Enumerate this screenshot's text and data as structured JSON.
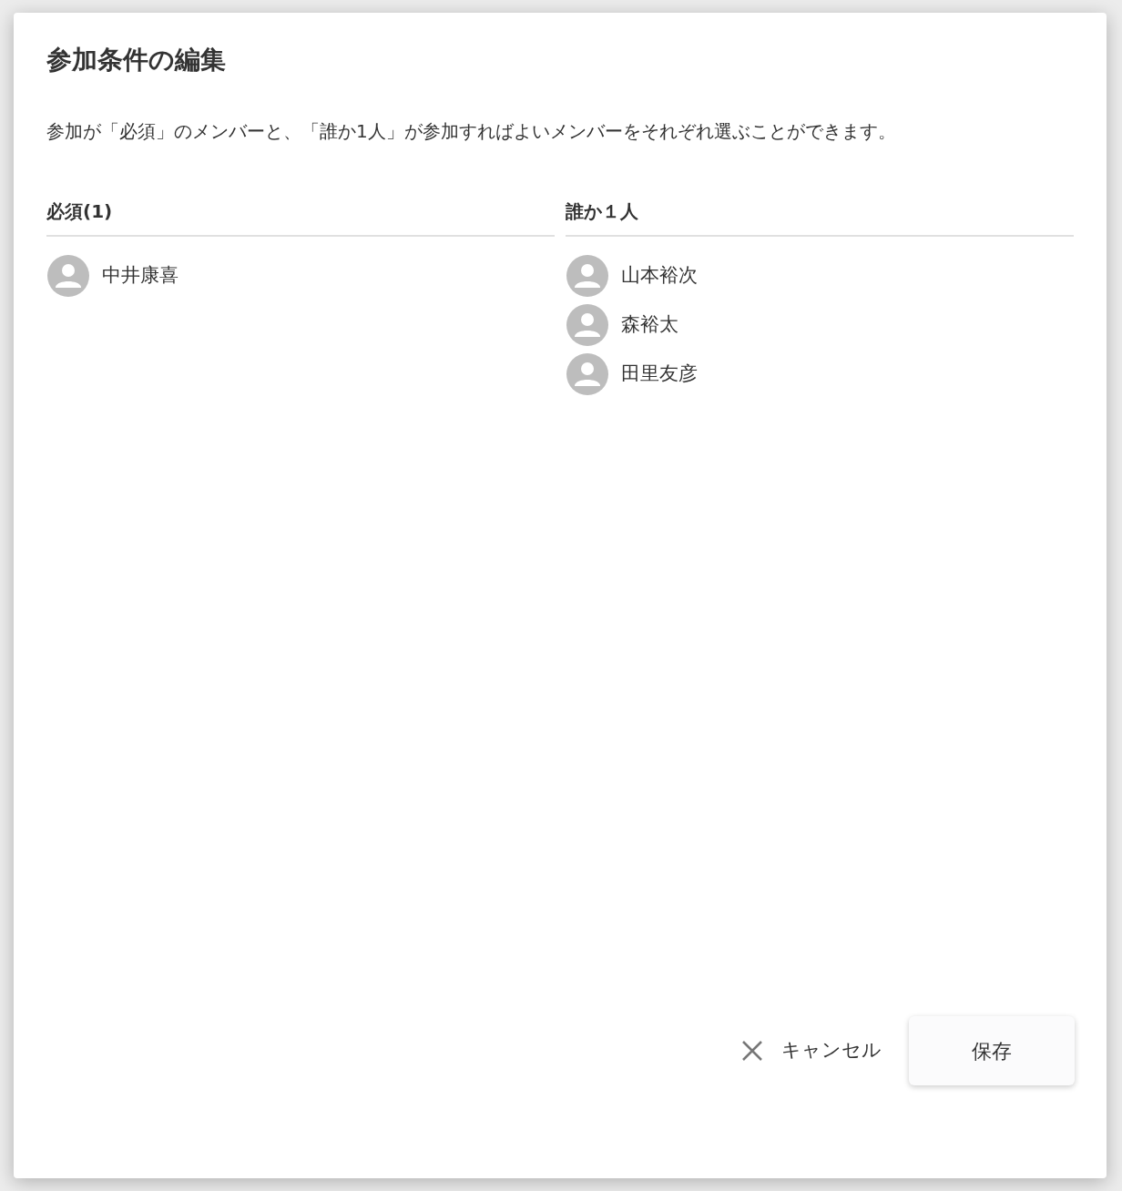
{
  "dialog": {
    "title": "参加条件の編集",
    "description": "参加が「必須」のメンバーと、「誰か1人」が参加すればよいメンバーをそれぞれ選ぶことができます。",
    "columns": [
      {
        "heading": "必須(1)",
        "members": [
          "中井康喜"
        ]
      },
      {
        "heading": "誰か１人",
        "members": [
          "山本裕次",
          "森裕太",
          "田里友彦"
        ]
      }
    ],
    "buttons": {
      "cancel": "キャンセル",
      "save": "保存"
    }
  }
}
